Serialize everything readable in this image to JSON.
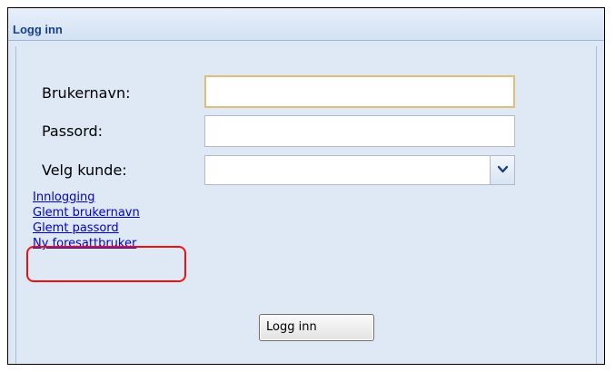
{
  "window": {
    "title": "Logg inn"
  },
  "form": {
    "username_label": "Brukernavn:",
    "username_value": "",
    "password_label": "Passord:",
    "password_value": "",
    "customer_label": "Velg kunde:",
    "customer_value": ""
  },
  "links": [
    {
      "label": "Innlogging"
    },
    {
      "label": "Glemt brukernavn"
    },
    {
      "label": "Glemt passord"
    },
    {
      "label": "Ny foresattbruker"
    }
  ],
  "buttons": {
    "login_label": "Logg inn"
  },
  "icons": {
    "dropdown": "chevron-down-icon"
  },
  "colors": {
    "title_text": "#15428b",
    "link": "#0000cc",
    "highlight": "#ee1111",
    "focus_border": "#e0be7a"
  }
}
